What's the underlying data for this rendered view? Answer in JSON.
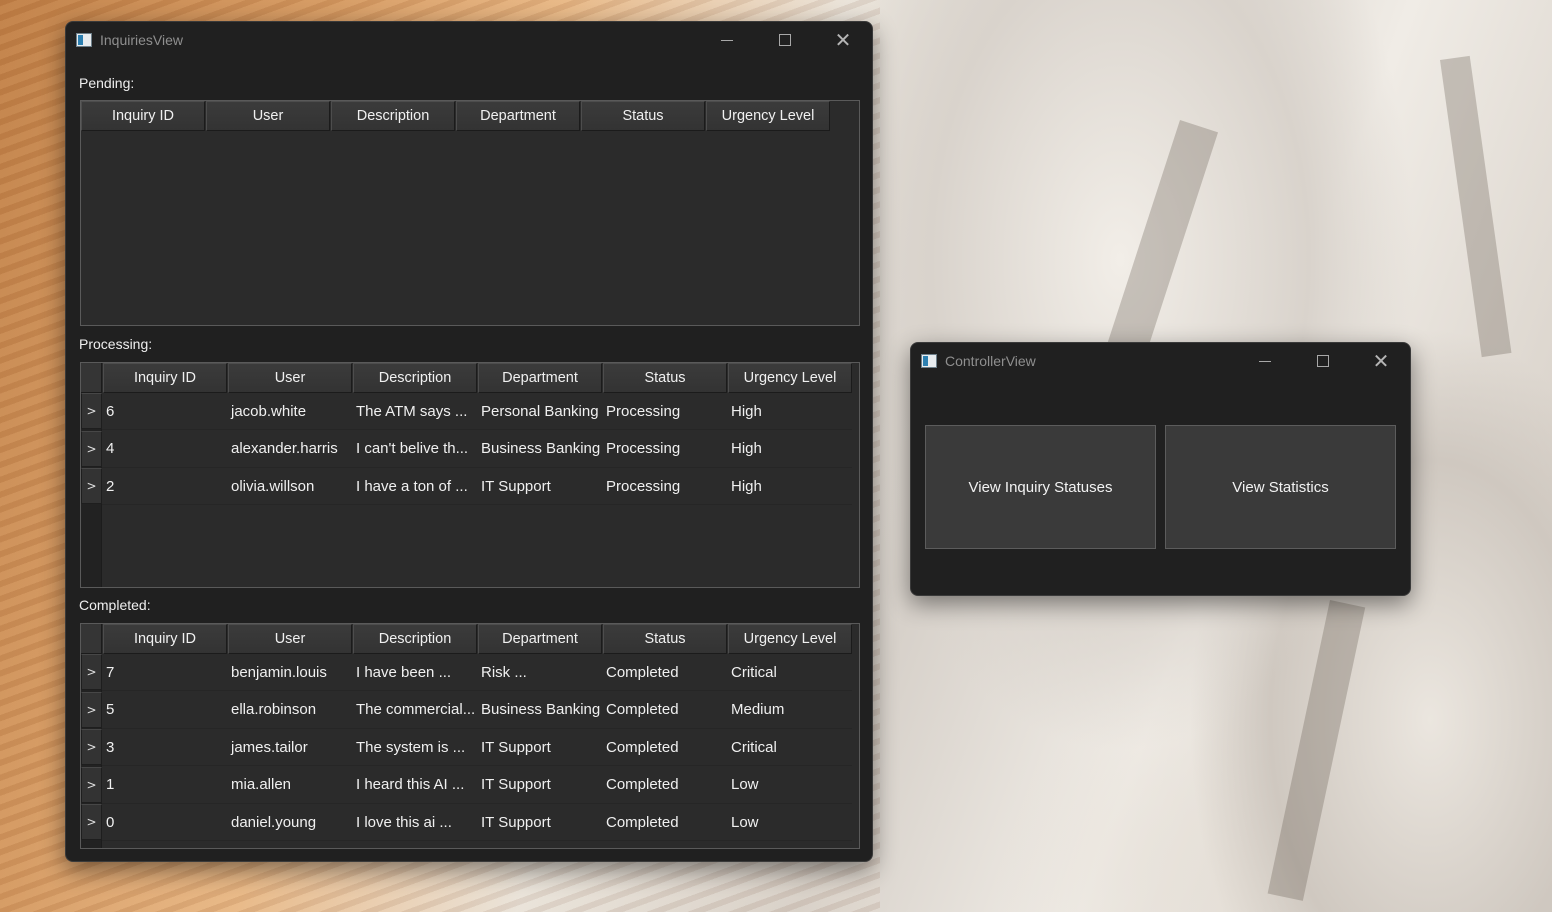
{
  "inquiries_window": {
    "title": "InquiriesView",
    "pending_label": "Pending:",
    "processing_label": "Processing:",
    "completed_label": "Completed:",
    "columns": [
      "Inquiry ID",
      "User",
      "Description",
      "Department",
      "Status",
      "Urgency Level"
    ],
    "row_marker": ">",
    "pending_rows": [],
    "processing_rows": [
      [
        "6",
        "jacob.white",
        "The ATM says ...",
        "Personal Banking",
        "Processing",
        "High"
      ],
      [
        "4",
        "alexander.harris",
        "I can't belive th...",
        "Business Banking",
        "Processing",
        "High"
      ],
      [
        "2",
        "olivia.willson",
        "I have a ton of ...",
        "IT Support",
        "Processing",
        "High"
      ]
    ],
    "completed_rows": [
      [
        "7",
        "benjamin.louis",
        "I have been ...",
        "Risk ...",
        "Completed",
        "Critical"
      ],
      [
        "5",
        "ella.robinson",
        "The commercial...",
        "Business Banking",
        "Completed",
        "Medium"
      ],
      [
        "3",
        "james.tailor",
        "The system is ...",
        "IT Support",
        "Completed",
        "Critical"
      ],
      [
        "1",
        "mia.allen",
        "I heard this AI ...",
        "IT Support",
        "Completed",
        "Low"
      ],
      [
        "0",
        "daniel.young",
        "I love this ai ...",
        "IT Support",
        "Completed",
        "Low"
      ]
    ]
  },
  "controller_window": {
    "title": "ControllerView",
    "view_statuses_label": "View Inquiry Statuses",
    "view_statistics_label": "View Statistics"
  },
  "colors": {
    "window_bg": "#202020",
    "table_bg": "#2b2b2b",
    "header_bg": "#363636",
    "button_bg": "#3a3a3a"
  }
}
